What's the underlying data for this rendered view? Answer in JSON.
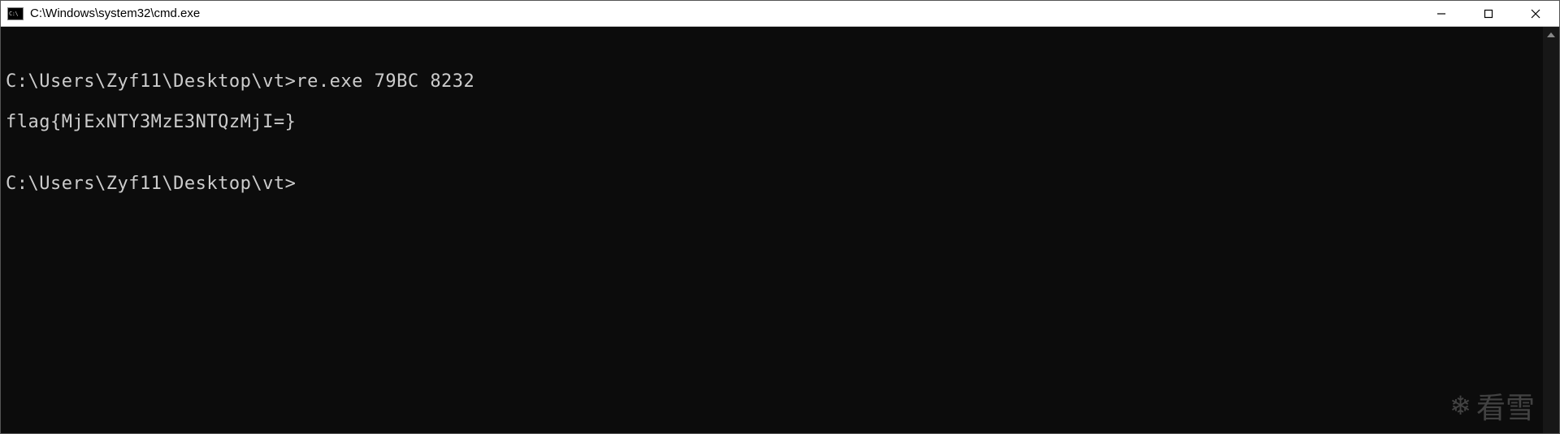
{
  "window": {
    "title": "C:\\Windows\\system32\\cmd.exe",
    "icon_label": "C:\\"
  },
  "terminal": {
    "lines": [
      "",
      "C:\\Users\\Zyf11\\Desktop\\vt>re.exe 79BC 8232",
      "flag{MjExNTY3MzE3NTQzMjI=}",
      "",
      "C:\\Users\\Zyf11\\Desktop\\vt>"
    ]
  },
  "watermark": {
    "icon": "❄",
    "text": "看雪"
  }
}
